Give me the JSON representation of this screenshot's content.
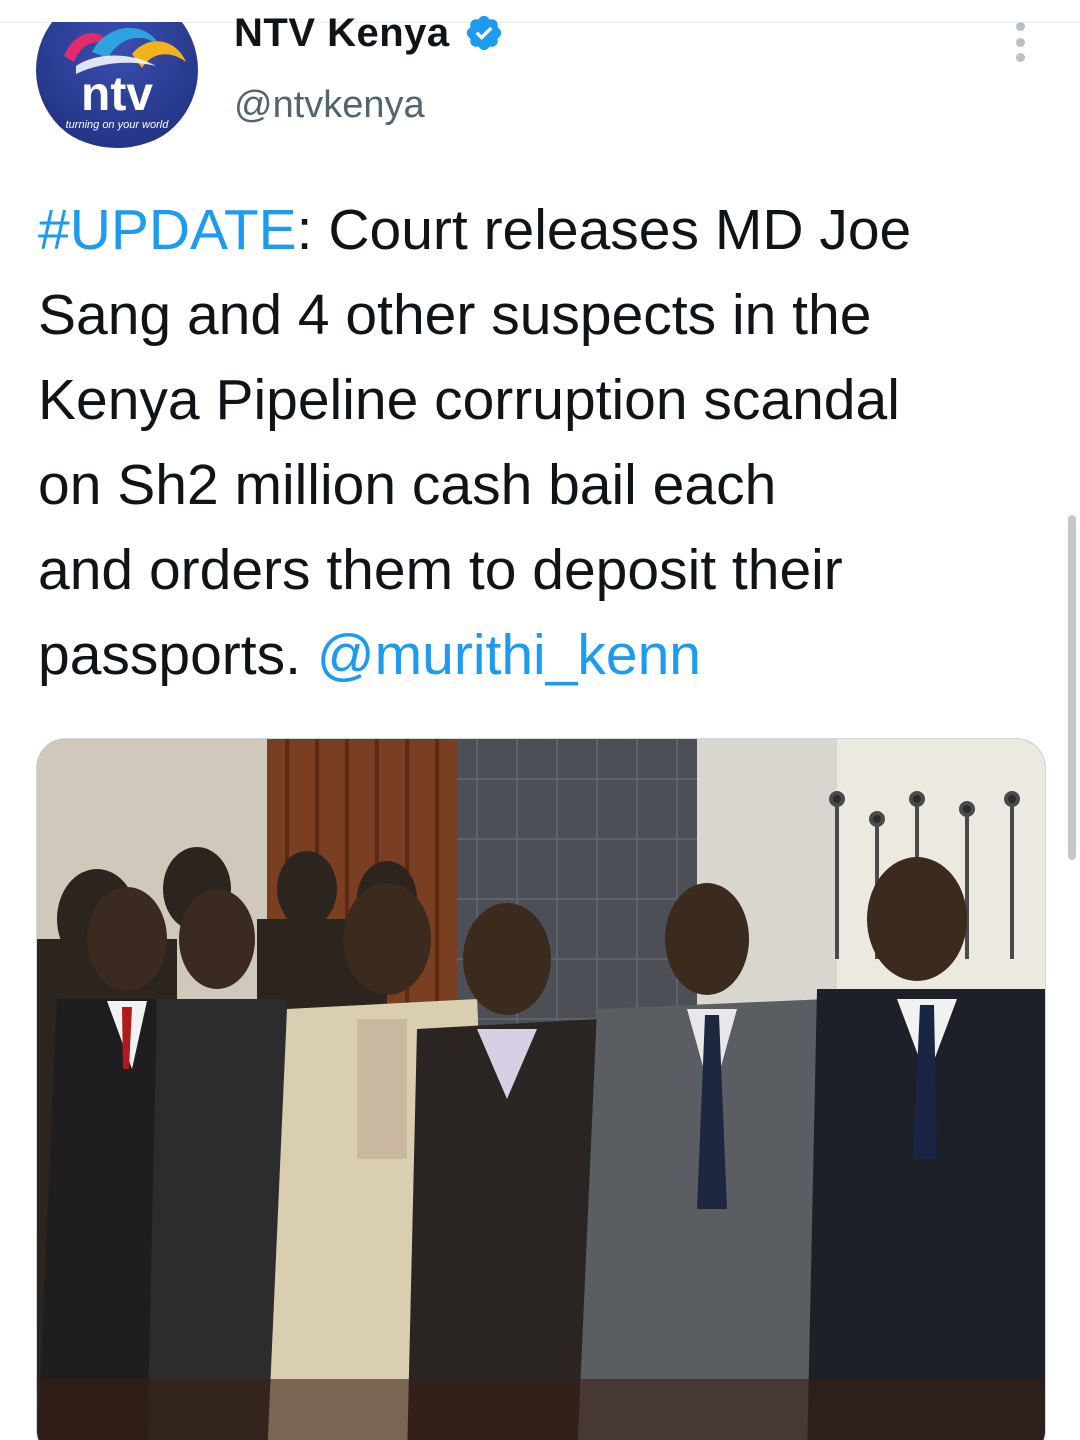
{
  "account": {
    "display_name": "NTV Kenya",
    "handle": "@ntvkenya",
    "verified": true,
    "avatar": {
      "logo_text": "ntv",
      "tagline": "turning on your world"
    }
  },
  "tweet": {
    "hashtag": "#UPDATE",
    "line1_rest": ": Court releases MD Joe",
    "line2": "Sang and 4 other suspects in the",
    "line3": "Kenya Pipeline corruption scandal",
    "line4": "on Sh2 million cash bail each",
    "line5": "and orders them to deposit their",
    "line6_text": "passports. ",
    "mention": "@murithi_kenn"
  },
  "media": {
    "alt": "courtroom-photo",
    "description_icon": "photo"
  },
  "colors": {
    "link": "#1d9bf0",
    "text": "#0f1419",
    "secondary": "#536471",
    "verified": "#1d9bf0",
    "avatar_bg": "#2a3c96"
  }
}
